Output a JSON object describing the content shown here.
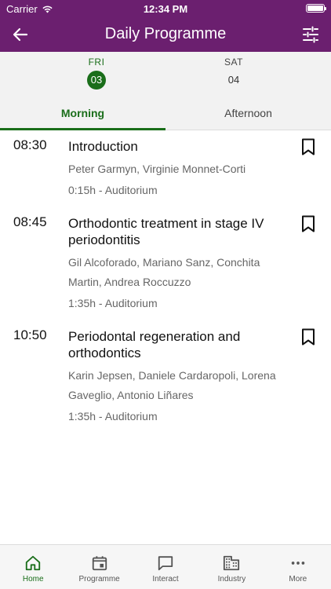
{
  "status": {
    "carrier": "Carrier",
    "time": "12:34 PM"
  },
  "header": {
    "title": "Daily Programme"
  },
  "days": [
    {
      "name": "FRI",
      "number": "03",
      "selected": true
    },
    {
      "name": "SAT",
      "number": "04",
      "selected": false
    }
  ],
  "tabs": [
    {
      "label": "Morning",
      "selected": true
    },
    {
      "label": "Afternoon",
      "selected": false
    }
  ],
  "sessions": [
    {
      "time": "08:30",
      "title": "Introduction",
      "speakers": "Peter Garmyn, Virginie Monnet-Corti",
      "meta": "0:15h - Auditorium"
    },
    {
      "time": "08:45",
      "title": "Orthodontic treatment in stage IV periodontitis",
      "speakers": "Gil Alcoforado, Mariano Sanz, Conchita Martin, Andrea Roccuzzo",
      "meta": "1:35h - Auditorium"
    },
    {
      "time": "10:50",
      "title": "Periodontal regeneration and orthodontics",
      "speakers": "Karin Jepsen, Daniele Cardaropoli, Lorena Gaveglio, Antonio Liñares",
      "meta": "1:35h - Auditorium"
    }
  ],
  "bottom_nav": [
    {
      "label": "Home",
      "icon": "home-icon",
      "active": true
    },
    {
      "label": "Programme",
      "icon": "calendar-icon",
      "active": false
    },
    {
      "label": "Interact",
      "icon": "chat-icon",
      "active": false
    },
    {
      "label": "Industry",
      "icon": "building-icon",
      "active": false
    },
    {
      "label": "More",
      "icon": "more-icon",
      "active": false
    }
  ],
  "colors": {
    "brand": "#6b1f6f",
    "accent": "#1a6e1a"
  }
}
